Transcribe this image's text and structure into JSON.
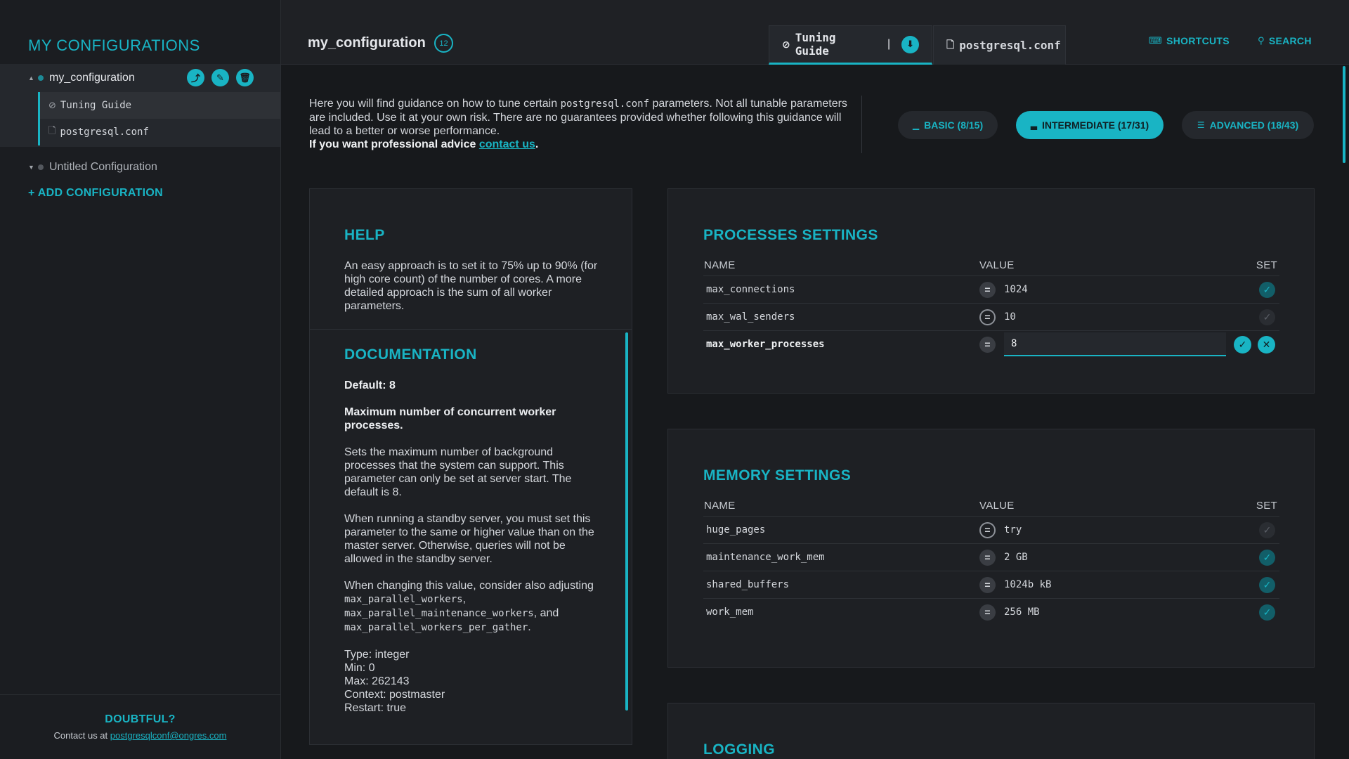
{
  "sidebar": {
    "title": "MY CONFIGURATIONS",
    "configs": [
      {
        "name": "my_configuration",
        "items": [
          {
            "label": "Tuning Guide"
          },
          {
            "label": "postgresql.conf"
          }
        ]
      },
      {
        "name": "Untitled Configuration"
      }
    ],
    "add_label": "+ ADD CONFIGURATION",
    "footer_title": "DOUBTFUL?",
    "footer_prefix": "Contact us at",
    "footer_email": "postgresqlconf@ongres.com"
  },
  "header": {
    "title": "my_configuration",
    "badge": "12",
    "tabs": [
      {
        "label": "Tuning Guide"
      },
      {
        "label": "postgresql.conf"
      }
    ],
    "tab_separator": "|",
    "shortcuts_label": "SHORTCUTS",
    "search_label": "SEARCH"
  },
  "intro": {
    "text_1": "Here you will find guidance on how to tune certain",
    "code": "postgresql.conf",
    "text_2": "parameters. Not all tunable parameters are included. Use it at your own risk. There are no guarantees provided whether following this guidance will lead to a better or worse performance.",
    "advice": "If you want professional advice",
    "link": "contact us",
    "period": "."
  },
  "levels": [
    {
      "label": "BASIC (8/15)"
    },
    {
      "label": "INTERMEDIATE (17/31)"
    },
    {
      "label": "ADVANCED (18/43)"
    }
  ],
  "help": {
    "heading": "HELP",
    "text": "An easy approach is to set it to 75% up to 90% (for high core count) of the number of cores. A more detailed approach is the sum of all worker parameters.",
    "doc_heading": "DOCUMENTATION",
    "default": "Default: 8",
    "summary": "Maximum number of concurrent worker processes.",
    "para_1": "Sets the maximum number of background processes that the system can support. This parameter can only be set at server start. The default is 8.",
    "para_2": "When running a standby server, you must set this parameter to the same or higher value than on the master server. Otherwise, queries will not be allowed in the standby server.",
    "para_3_prefix": "When changing this value, consider also adjusting",
    "para_3_code_1": "max_parallel_workers",
    "para_3_comma": ",",
    "para_3_code_2": "max_parallel_maintenance_workers",
    "para_3_and": ", and",
    "para_3_code_3": "max_parallel_workers_per_gather",
    "para_3_end": ".",
    "type": "Type: integer",
    "min": "Min: 0",
    "max": "Max: 262143",
    "context": "Context: postmaster",
    "restart": "Restart: true"
  },
  "columns": {
    "name": "NAME",
    "value": "VALUE",
    "set": "SET"
  },
  "processes": {
    "heading": "PROCESSES SETTINGS",
    "rows": [
      {
        "name": "max_connections",
        "value": "1024"
      },
      {
        "name": "max_wal_senders",
        "value": "10"
      },
      {
        "name": "max_worker_processes",
        "value": "8"
      }
    ]
  },
  "memory": {
    "heading": "MEMORY SETTINGS",
    "rows": [
      {
        "name": "huge_pages",
        "value": "try"
      },
      {
        "name": "maintenance_work_mem",
        "value": "2 GB"
      },
      {
        "name": "shared_buffers",
        "value": "1024b kB"
      },
      {
        "name": "work_mem",
        "value": "256 MB"
      }
    ]
  },
  "logging": {
    "heading": "LOGGING"
  },
  "colors": {
    "accent": "#19b4c4",
    "background": "#17191c",
    "panel": "#1e2024"
  }
}
